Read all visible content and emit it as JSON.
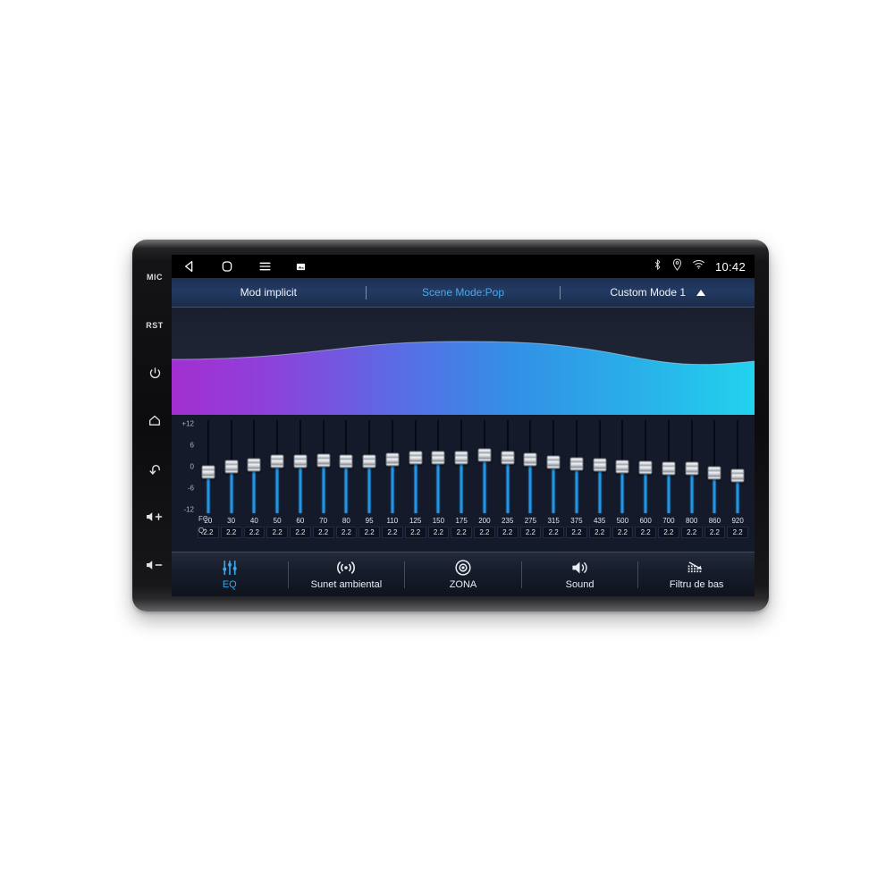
{
  "device": {
    "hardware_keys": [
      {
        "name": "mic-key",
        "label": "MIC",
        "icon": "text"
      },
      {
        "name": "reset-key",
        "label": "RST",
        "icon": "text"
      },
      {
        "name": "power-key",
        "label": "",
        "icon": "power-icon"
      },
      {
        "name": "home-key",
        "label": "",
        "icon": "home-icon"
      },
      {
        "name": "back-key",
        "label": "",
        "icon": "back-arrow-icon"
      },
      {
        "name": "volume-up-key",
        "label": "",
        "icon": "volume-up-icon"
      },
      {
        "name": "volume-down-key",
        "label": "",
        "icon": "volume-down-icon"
      }
    ]
  },
  "statusbar": {
    "nav": [
      {
        "name": "back-icon",
        "glyph": "triangle-left"
      },
      {
        "name": "home-icon",
        "glyph": "rounded-square"
      },
      {
        "name": "menu-icon",
        "glyph": "hamburger"
      },
      {
        "name": "screenshot-icon",
        "glyph": "image"
      }
    ],
    "indicators": [
      {
        "name": "bluetooth-icon"
      },
      {
        "name": "location-icon"
      },
      {
        "name": "wifi-icon"
      }
    ],
    "clock": "10:42"
  },
  "modebar": {
    "default_mode": "Mod implicit",
    "scene_mode": "Scene Mode:Pop",
    "custom_mode": "Custom Mode 1",
    "scene_color": "#4aa8ea"
  },
  "waveform": {
    "gradient": [
      "#a32fd0",
      "#6b5fe0",
      "#2f8fe8",
      "#22d3ee"
    ],
    "background": "#202637"
  },
  "equalizer": {
    "y_ticks": [
      "+12",
      "6",
      "0",
      "-6",
      "-12"
    ],
    "y_range": [
      -12,
      12
    ],
    "fc_label": "FC:",
    "q_label": "Q:",
    "slider_color": "#2196e8",
    "bands": [
      {
        "fc": "20",
        "q": "2.2",
        "gain": -1.5
      },
      {
        "fc": "30",
        "q": "2.2",
        "gain": 0.0
      },
      {
        "fc": "40",
        "q": "2.2",
        "gain": 0.4
      },
      {
        "fc": "50",
        "q": "2.2",
        "gain": 1.6
      },
      {
        "fc": "60",
        "q": "2.2",
        "gain": 1.4
      },
      {
        "fc": "70",
        "q": "2.2",
        "gain": 1.8
      },
      {
        "fc": "80",
        "q": "2.2",
        "gain": 1.6
      },
      {
        "fc": "95",
        "q": "2.2",
        "gain": 1.5
      },
      {
        "fc": "110",
        "q": "2.2",
        "gain": 2.0
      },
      {
        "fc": "125",
        "q": "2.2",
        "gain": 2.4
      },
      {
        "fc": "150",
        "q": "2.2",
        "gain": 2.6
      },
      {
        "fc": "175",
        "q": "2.2",
        "gain": 2.4
      },
      {
        "fc": "200",
        "q": "2.2",
        "gain": 3.2
      },
      {
        "fc": "235",
        "q": "2.2",
        "gain": 2.6
      },
      {
        "fc": "275",
        "q": "2.2",
        "gain": 2.1
      },
      {
        "fc": "315",
        "q": "2.2",
        "gain": 1.2
      },
      {
        "fc": "375",
        "q": "2.2",
        "gain": 0.8
      },
      {
        "fc": "435",
        "q": "2.2",
        "gain": 0.6
      },
      {
        "fc": "500",
        "q": "2.2",
        "gain": 0.1
      },
      {
        "fc": "600",
        "q": "2.2",
        "gain": -0.3
      },
      {
        "fc": "700",
        "q": "2.2",
        "gain": -0.4
      },
      {
        "fc": "800",
        "q": "2.2",
        "gain": -0.6
      },
      {
        "fc": "860",
        "q": "2.2",
        "gain": -1.8
      },
      {
        "fc": "920",
        "q": "2.2",
        "gain": -2.4
      }
    ]
  },
  "bottomnav": {
    "active_color": "#3aa8ea",
    "items": [
      {
        "name": "nav-eq",
        "label": "EQ",
        "icon": "equalizer-icon",
        "active": true
      },
      {
        "name": "nav-ambient",
        "label": "Sunet ambiental",
        "icon": "surround-icon",
        "active": false
      },
      {
        "name": "nav-zone",
        "label": "ZONA",
        "icon": "zone-target-icon",
        "active": false
      },
      {
        "name": "nav-sound",
        "label": "Sound",
        "icon": "speaker-icon",
        "active": false
      },
      {
        "name": "nav-bass",
        "label": "Filtru de bas",
        "icon": "lowpass-icon",
        "active": false
      }
    ]
  }
}
